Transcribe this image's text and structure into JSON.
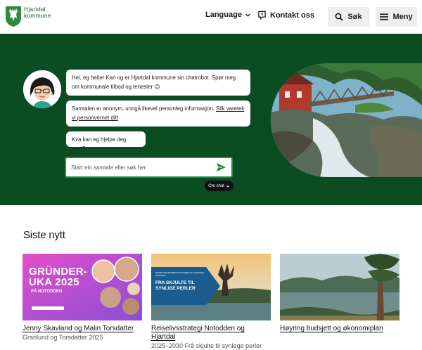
{
  "header": {
    "logo_line1": "Hjartdal",
    "logo_line2": "kommune",
    "language_label": "Language",
    "contact_label": "Kontakt oss",
    "search_label": "Søk",
    "menu_label": "Meny"
  },
  "hero": {
    "messages": [
      "Hei, eg heiter Kari og er Hjartdal kommune sin chatrobot. Spør meg om kommunale tilbod og tenester 😊",
      "Samtalen er anonym, unngå likevel personleg informasjon. ",
      "Kva kan eg hjelpe deg med?"
    ],
    "privacy_link": "Slik varetek vi personvernet ditt",
    "input_placeholder": "Start ein samtale eller søk her",
    "about_chat_label": "Om chat"
  },
  "news": {
    "heading": "Siste nytt",
    "cards": [
      {
        "title": "Jenny Skavland og Malin Torsdatter",
        "sub": "Granlund og Torsdatter 2025",
        "poster_title_1": "GRÜNDER-",
        "poster_title_2": "UKA 2025",
        "poster_sub": "PÅ NOTODDEN"
      },
      {
        "title": "Reiselivsstrategi Notodden og Hjartdal",
        "sub": "2025–2030 Frå skjulte til synlege perler",
        "label_small": "REISELIVSSTRATEGI NOTODDEN OG HJARTDAL 2025-2030",
        "label_big": "FRA SKJULTE TIL SYNLIGE PERLER"
      },
      {
        "title": "Høyring budsjett og økonomiplan",
        "sub": ""
      }
    ]
  },
  "colors": {
    "brand_green": "#0a4d23",
    "accent_green": "#1d8a40"
  }
}
